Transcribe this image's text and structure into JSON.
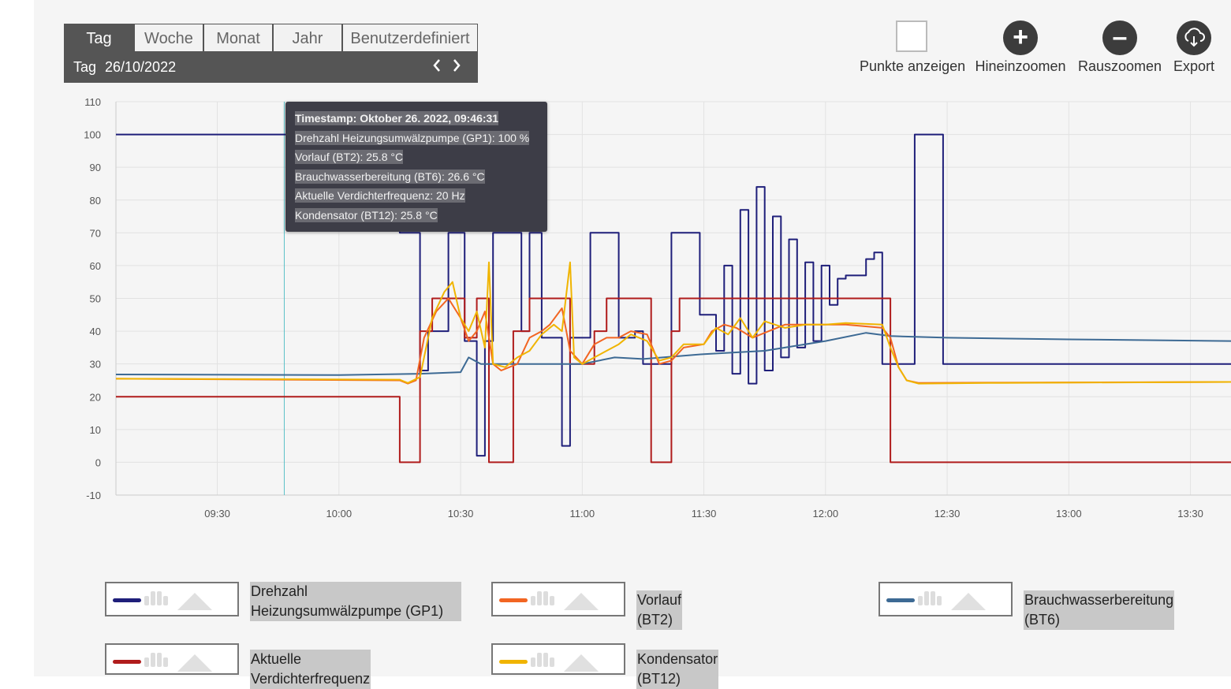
{
  "period": {
    "tabs": [
      "Tag",
      "Woche",
      "Monat",
      "Jahr",
      "Benutzerdefiniert"
    ],
    "active_tab": "Tag",
    "label": "Tag",
    "date": "26/10/2022",
    "prev_icon": "chevron-left-icon",
    "next_icon": "chevron-right-icon"
  },
  "toolbar": {
    "points": "Punkte anzeigen",
    "zoom_in": "Hineinzoomen",
    "zoom_out": "Rauszoomen",
    "export": "Export",
    "zoom_in_icon": "plus-icon",
    "zoom_out_icon": "minus-icon",
    "export_icon": "cloud-download-icon"
  },
  "tooltip": {
    "timestamp": "Timestamp: Oktober 26. 2022, 09:46:31",
    "lines": [
      "Drehzahl Heizungsumwälzpumpe (GP1): 100 %",
      "Vorlauf (BT2): 25.8 °C",
      "Brauchwasserbereitung (BT6): 26.6 °C",
      "Aktuelle Verdichterfrequenz: 20 Hz",
      "Kondensator (BT12): 25.8 °C"
    ]
  },
  "legend": [
    {
      "label": "Drehzahl Heizungsumwälzpumpe (GP1)",
      "color": "#1f1f7a"
    },
    {
      "label": "Vorlauf (BT2)",
      "color": "#f26522"
    },
    {
      "label": "Brauchwasserbereitung (BT6)",
      "color": "#3d6a94"
    },
    {
      "label": "Aktuelle Verdichterfrequenz",
      "color": "#b01c1c"
    },
    {
      "label": "Kondensator (BT12)",
      "color": "#f0b400"
    }
  ],
  "chart_data": {
    "type": "line",
    "title": "",
    "xlabel": "",
    "ylabel": "",
    "ylim": [
      -10,
      110
    ],
    "yticks": [
      -10,
      0,
      10,
      20,
      30,
      40,
      50,
      60,
      70,
      80,
      90,
      100,
      110
    ],
    "xlim": [
      "09:05",
      "13:40"
    ],
    "xticks": [
      "09:30",
      "10:00",
      "10:30",
      "11:00",
      "11:30",
      "12:00",
      "12:30",
      "13:00",
      "13:30"
    ],
    "grid": true,
    "cursor_x": "09:46:31",
    "series": [
      {
        "name": "Drehzahl Heizungsumwälzpumpe (GP1)",
        "color": "#1f1f7a",
        "step": true,
        "points": [
          [
            "09:05",
            100
          ],
          [
            "10:15",
            100
          ],
          [
            "10:15",
            70
          ],
          [
            "10:20",
            70
          ],
          [
            "10:20",
            28
          ],
          [
            "10:22",
            28
          ],
          [
            "10:22",
            40
          ],
          [
            "10:27",
            40
          ],
          [
            "10:27",
            70
          ],
          [
            "10:31",
            70
          ],
          [
            "10:31",
            37
          ],
          [
            "10:34",
            37
          ],
          [
            "10:34",
            2
          ],
          [
            "10:36",
            2
          ],
          [
            "10:36",
            37
          ],
          [
            "10:38",
            37
          ],
          [
            "10:38",
            70
          ],
          [
            "10:45",
            70
          ],
          [
            "10:45",
            40
          ],
          [
            "10:47",
            40
          ],
          [
            "10:47",
            70
          ],
          [
            "10:50",
            70
          ],
          [
            "10:50",
            38
          ],
          [
            "10:55",
            38
          ],
          [
            "10:55",
            5
          ],
          [
            "10:57",
            5
          ],
          [
            "10:57",
            38
          ],
          [
            "11:02",
            38
          ],
          [
            "11:02",
            70
          ],
          [
            "11:09",
            70
          ],
          [
            "11:09",
            38
          ],
          [
            "11:13",
            38
          ],
          [
            "11:13",
            40
          ],
          [
            "11:15",
            40
          ],
          [
            "11:15",
            30
          ],
          [
            "11:22",
            30
          ],
          [
            "11:22",
            70
          ],
          [
            "11:29",
            70
          ],
          [
            "11:29",
            45
          ],
          [
            "11:33",
            45
          ],
          [
            "11:33",
            34
          ],
          [
            "11:35",
            34
          ],
          [
            "11:35",
            60
          ],
          [
            "11:37",
            60
          ],
          [
            "11:37",
            27
          ],
          [
            "11:39",
            27
          ],
          [
            "11:39",
            77
          ],
          [
            "11:41",
            77
          ],
          [
            "11:41",
            24
          ],
          [
            "11:43",
            24
          ],
          [
            "11:43",
            84
          ],
          [
            "11:45",
            84
          ],
          [
            "11:45",
            28
          ],
          [
            "11:47",
            28
          ],
          [
            "11:47",
            75
          ],
          [
            "11:49",
            75
          ],
          [
            "11:49",
            32
          ],
          [
            "11:51",
            32
          ],
          [
            "11:51",
            68
          ],
          [
            "11:53",
            68
          ],
          [
            "11:53",
            35
          ],
          [
            "11:55",
            35
          ],
          [
            "11:55",
            61
          ],
          [
            "11:57",
            61
          ],
          [
            "11:57",
            37
          ],
          [
            "11:59",
            37
          ],
          [
            "11:59",
            60
          ],
          [
            "12:01",
            60
          ],
          [
            "12:01",
            48
          ],
          [
            "12:03",
            48
          ],
          [
            "12:03",
            56
          ],
          [
            "12:05",
            56
          ],
          [
            "12:05",
            57
          ],
          [
            "12:10",
            57
          ],
          [
            "12:10",
            62
          ],
          [
            "12:12",
            62
          ],
          [
            "12:12",
            64
          ],
          [
            "12:14",
            64
          ],
          [
            "12:14",
            30
          ],
          [
            "12:22",
            30
          ],
          [
            "12:22",
            100
          ],
          [
            "12:29",
            100
          ],
          [
            "12:29",
            30
          ],
          [
            "13:40",
            30
          ]
        ]
      },
      {
        "name": "Aktuelle Verdichterfrequenz",
        "color": "#b01c1c",
        "step": true,
        "points": [
          [
            "09:05",
            20
          ],
          [
            "10:15",
            20
          ],
          [
            "10:15",
            0
          ],
          [
            "10:20",
            0
          ],
          [
            "10:20",
            40
          ],
          [
            "10:23",
            40
          ],
          [
            "10:23",
            50
          ],
          [
            "10:31",
            50
          ],
          [
            "10:31",
            38
          ],
          [
            "10:34",
            38
          ],
          [
            "10:34",
            50
          ],
          [
            "10:37",
            50
          ],
          [
            "10:37",
            0
          ],
          [
            "10:43",
            0
          ],
          [
            "10:43",
            40
          ],
          [
            "10:47",
            40
          ],
          [
            "10:47",
            50
          ],
          [
            "10:57",
            50
          ],
          [
            "10:57",
            30
          ],
          [
            "11:03",
            30
          ],
          [
            "11:03",
            40
          ],
          [
            "11:06",
            40
          ],
          [
            "11:06",
            50
          ],
          [
            "11:17",
            50
          ],
          [
            "11:17",
            0
          ],
          [
            "11:22",
            0
          ],
          [
            "11:22",
            40
          ],
          [
            "11:24",
            40
          ],
          [
            "11:24",
            50
          ],
          [
            "12:16",
            50
          ],
          [
            "12:16",
            0
          ],
          [
            "13:40",
            0
          ]
        ]
      },
      {
        "name": "Brauchwasserbereitung (BT6)",
        "color": "#3d6a94",
        "step": false,
        "points": [
          [
            "09:05",
            26.8
          ],
          [
            "10:00",
            26.6
          ],
          [
            "10:20",
            27
          ],
          [
            "10:30",
            27.5
          ],
          [
            "10:32",
            32
          ],
          [
            "10:35",
            30
          ],
          [
            "10:45",
            30
          ],
          [
            "11:00",
            30
          ],
          [
            "11:08",
            32
          ],
          [
            "11:15",
            31.5
          ],
          [
            "11:30",
            33
          ],
          [
            "11:45",
            34
          ],
          [
            "12:00",
            37
          ],
          [
            "12:10",
            39.5
          ],
          [
            "12:16",
            38.5
          ],
          [
            "12:30",
            38
          ],
          [
            "13:00",
            37.5
          ],
          [
            "13:40",
            37
          ]
        ]
      },
      {
        "name": "Vorlauf (BT2)",
        "color": "#f26522",
        "step": false,
        "points": [
          [
            "09:05",
            25.5
          ],
          [
            "10:15",
            25
          ],
          [
            "10:17",
            24
          ],
          [
            "10:19",
            25
          ],
          [
            "10:21",
            38
          ],
          [
            "10:24",
            46
          ],
          [
            "10:27",
            50
          ],
          [
            "10:30",
            44
          ],
          [
            "10:32",
            37
          ],
          [
            "10:34",
            40
          ],
          [
            "10:36",
            46
          ],
          [
            "10:38",
            30
          ],
          [
            "10:40",
            28
          ],
          [
            "10:44",
            30
          ],
          [
            "10:47",
            38
          ],
          [
            "10:50",
            40
          ],
          [
            "10:52",
            42
          ],
          [
            "10:55",
            47
          ],
          [
            "10:57",
            34
          ],
          [
            "11:00",
            30
          ],
          [
            "11:03",
            36
          ],
          [
            "11:06",
            38
          ],
          [
            "11:09",
            38
          ],
          [
            "11:12",
            40
          ],
          [
            "11:16",
            39
          ],
          [
            "11:19",
            30
          ],
          [
            "11:22",
            31
          ],
          [
            "11:25",
            35
          ],
          [
            "11:30",
            36
          ],
          [
            "11:32",
            40
          ],
          [
            "11:35",
            42
          ],
          [
            "11:38",
            41
          ],
          [
            "11:42",
            38
          ],
          [
            "11:46",
            40
          ],
          [
            "11:50",
            42
          ],
          [
            "11:55",
            42
          ],
          [
            "12:00",
            42
          ],
          [
            "12:05",
            42
          ],
          [
            "12:14",
            41
          ],
          [
            "12:16",
            38
          ],
          [
            "12:18",
            29
          ],
          [
            "12:20",
            25
          ],
          [
            "12:23",
            24.2
          ],
          [
            "12:40",
            24.3
          ],
          [
            "13:40",
            24.5
          ]
        ]
      },
      {
        "name": "Kondensator (BT12)",
        "color": "#f0b400",
        "step": false,
        "points": [
          [
            "09:05",
            25.5
          ],
          [
            "10:15",
            25.2
          ],
          [
            "10:17",
            24.2
          ],
          [
            "10:20",
            26
          ],
          [
            "10:23",
            44
          ],
          [
            "10:26",
            52
          ],
          [
            "10:28",
            55
          ],
          [
            "10:30",
            44
          ],
          [
            "10:32",
            40
          ],
          [
            "10:34",
            46
          ],
          [
            "10:36",
            35
          ],
          [
            "10:37",
            61
          ],
          [
            "10:38",
            30
          ],
          [
            "10:41",
            29
          ],
          [
            "10:44",
            32
          ],
          [
            "10:47",
            34
          ],
          [
            "10:50",
            39
          ],
          [
            "10:53",
            42
          ],
          [
            "10:55",
            40
          ],
          [
            "10:57",
            61
          ],
          [
            "10:58",
            32
          ],
          [
            "11:00",
            30
          ],
          [
            "11:03",
            32
          ],
          [
            "11:06",
            34
          ],
          [
            "11:09",
            36
          ],
          [
            "11:12",
            39
          ],
          [
            "11:16",
            37
          ],
          [
            "11:19",
            31
          ],
          [
            "11:22",
            32
          ],
          [
            "11:25",
            36
          ],
          [
            "11:30",
            36
          ],
          [
            "11:33",
            41
          ],
          [
            "11:36",
            39
          ],
          [
            "11:39",
            44
          ],
          [
            "11:42",
            38
          ],
          [
            "11:45",
            43
          ],
          [
            "11:50",
            41
          ],
          [
            "11:55",
            42
          ],
          [
            "12:00",
            42
          ],
          [
            "12:05",
            42.5
          ],
          [
            "12:14",
            42
          ],
          [
            "12:16",
            35
          ],
          [
            "12:18",
            29
          ],
          [
            "12:20",
            25
          ],
          [
            "12:23",
            24
          ],
          [
            "12:40",
            24.2
          ],
          [
            "13:40",
            24.5
          ]
        ]
      }
    ]
  }
}
